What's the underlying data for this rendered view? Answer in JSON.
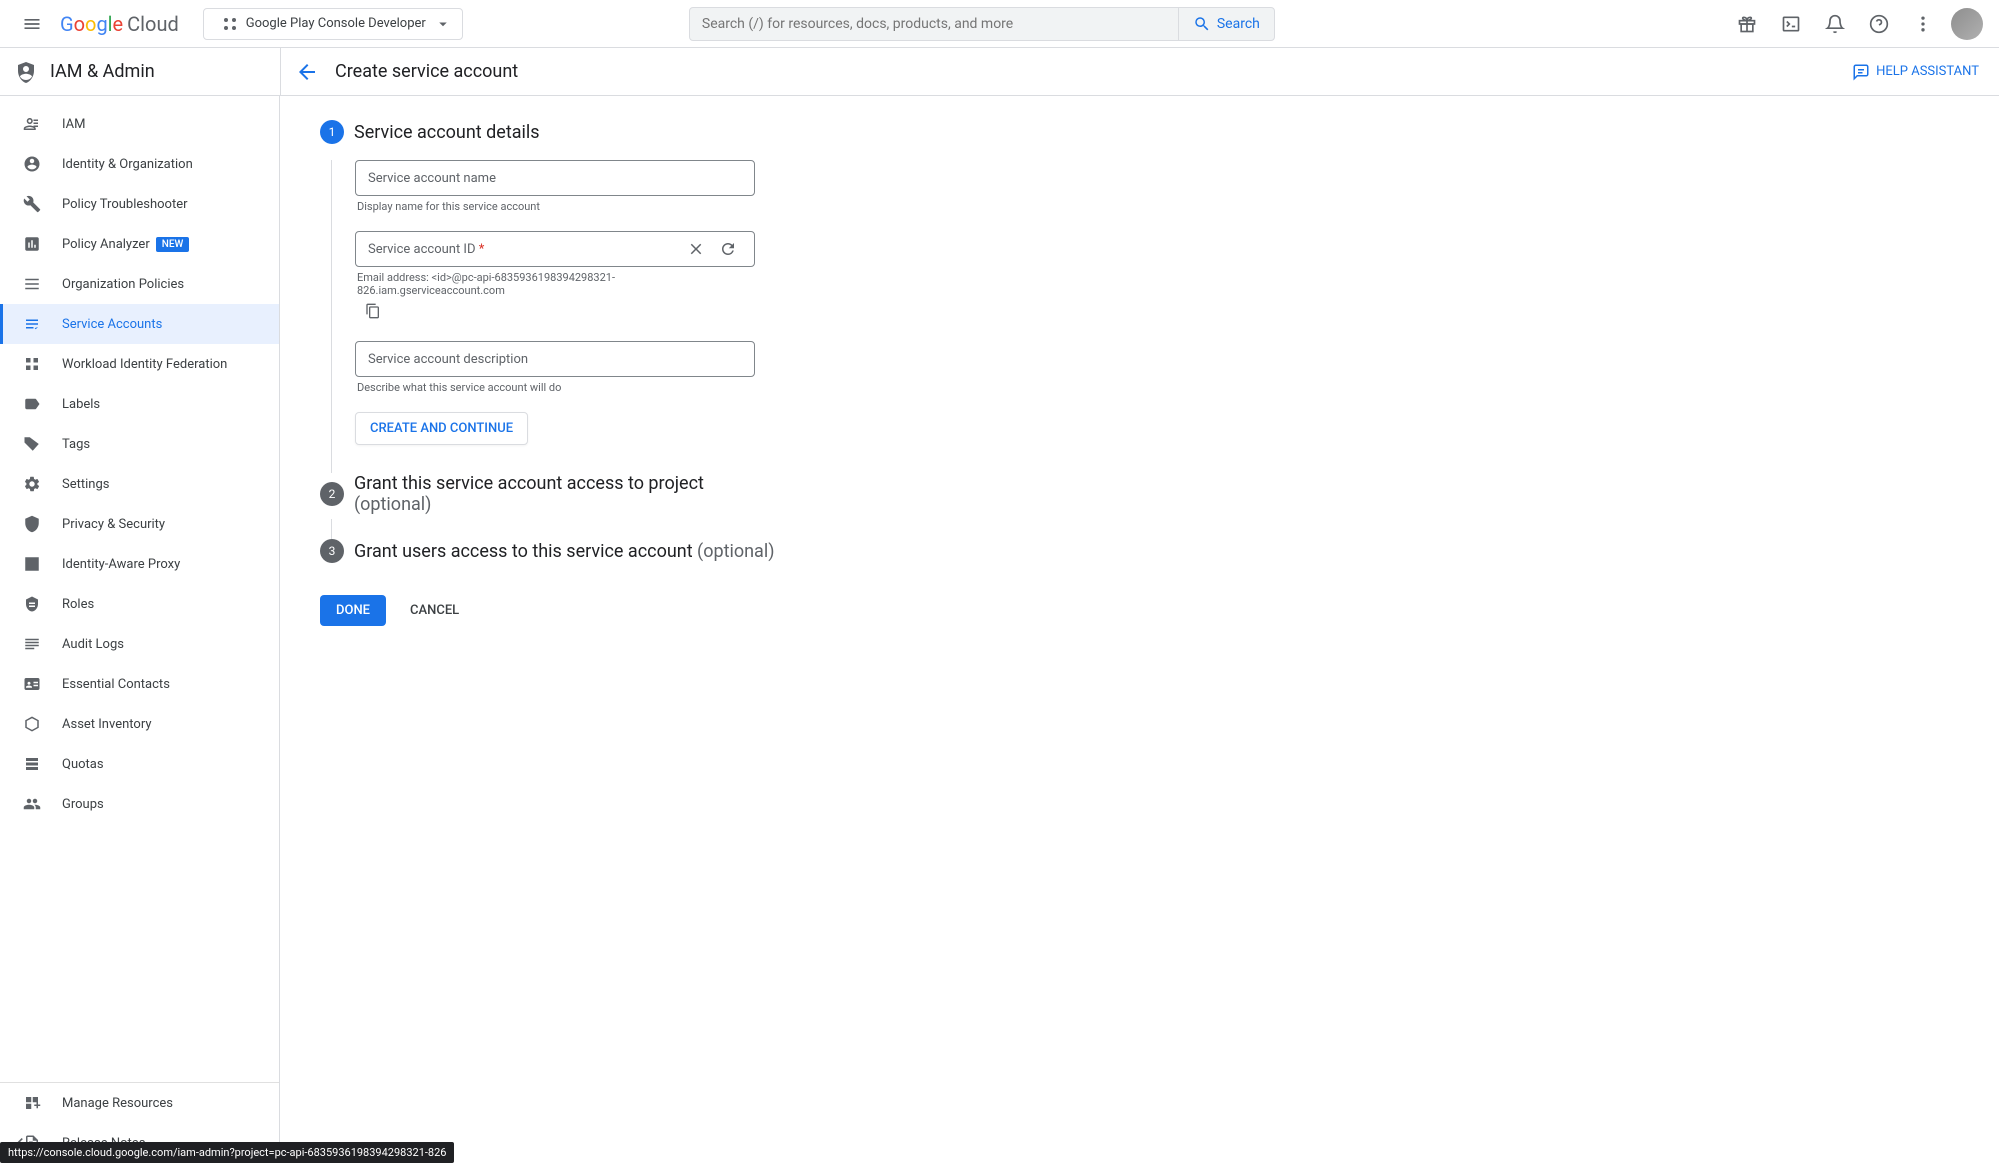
{
  "header": {
    "logo_product": "Cloud",
    "project": "Google Play Console Developer",
    "search_placeholder": "Search (/) for resources, docs, products, and more",
    "search_button": "Search"
  },
  "sub_header": {
    "section": "IAM & Admin",
    "page_title": "Create service account",
    "help_assistant": "HELP ASSISTANT"
  },
  "sidebar": {
    "items": [
      {
        "label": "IAM",
        "icon": "iam-icon"
      },
      {
        "label": "Identity & Organization",
        "icon": "person-icon"
      },
      {
        "label": "Policy Troubleshooter",
        "icon": "wrench-icon"
      },
      {
        "label": "Policy Analyzer",
        "icon": "analyzer-icon",
        "badge": "NEW"
      },
      {
        "label": "Organization Policies",
        "icon": "list-icon"
      },
      {
        "label": "Service Accounts",
        "icon": "accounts-icon",
        "active": true
      },
      {
        "label": "Workload Identity Federation",
        "icon": "federation-icon"
      },
      {
        "label": "Labels",
        "icon": "label-icon"
      },
      {
        "label": "Tags",
        "icon": "tag-icon"
      },
      {
        "label": "Settings",
        "icon": "gear-icon"
      },
      {
        "label": "Privacy & Security",
        "icon": "privacy-icon"
      },
      {
        "label": "Identity-Aware Proxy",
        "icon": "proxy-icon"
      },
      {
        "label": "Roles",
        "icon": "roles-icon"
      },
      {
        "label": "Audit Logs",
        "icon": "logs-icon"
      },
      {
        "label": "Essential Contacts",
        "icon": "contacts-icon"
      },
      {
        "label": "Asset Inventory",
        "icon": "inventory-icon"
      },
      {
        "label": "Quotas",
        "icon": "quotas-icon"
      },
      {
        "label": "Groups",
        "icon": "groups-icon"
      }
    ],
    "bottom": [
      {
        "label": "Manage Resources",
        "icon": "resources-icon"
      },
      {
        "label": "Release Notes",
        "icon": "notes-icon"
      }
    ]
  },
  "steps": {
    "s1": {
      "num": "1",
      "title": "Service account details",
      "name_label": "Service account name",
      "name_helper": "Display name for this service account",
      "id_label": "Service account ID",
      "id_helper": "Email address: <id>@pc-api-6835936198394298321-826.iam.gserviceaccount.com",
      "desc_label": "Service account description",
      "desc_helper": "Describe what this service account will do",
      "create_btn": "CREATE AND CONTINUE"
    },
    "s2": {
      "num": "2",
      "title": "Grant this service account access to project",
      "optional": "(optional)"
    },
    "s3": {
      "num": "3",
      "title": "Grant users access to this service account ",
      "optional": "(optional)"
    }
  },
  "buttons": {
    "done": "DONE",
    "cancel": "CANCEL"
  },
  "status_url": "https://console.cloud.google.com/iam-admin?project=pc-api-6835936198394298321-826"
}
